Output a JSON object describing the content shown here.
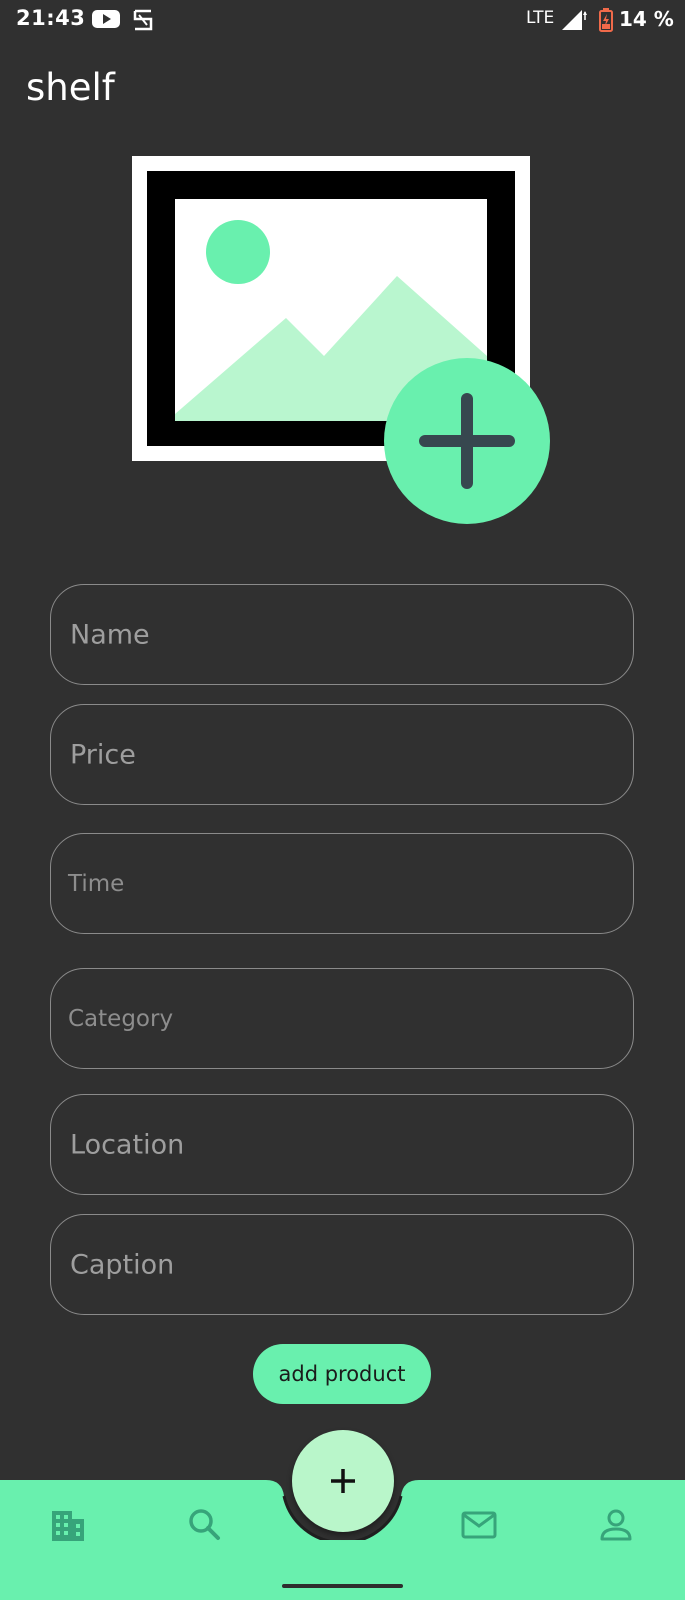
{
  "status_bar": {
    "time": "21:43",
    "network": "LTE",
    "battery": "14 %",
    "icons": [
      "youtube-icon",
      "s-app-icon",
      "signal-icon",
      "battery-icon"
    ]
  },
  "app_bar": {
    "title": "shelf"
  },
  "image_picker": {
    "placeholder_icon": "image-placeholder-icon",
    "add_icon": "plus-icon"
  },
  "form": {
    "name_label": "Name",
    "price_label": "Price",
    "time_label": "Time",
    "category_label": "Category",
    "location_label": "Location",
    "caption_label": "Caption",
    "submit_label": "add product"
  },
  "bottom_nav": {
    "items": [
      {
        "icon": "building-icon"
      },
      {
        "icon": "search-icon"
      },
      {
        "icon": "plus-icon"
      },
      {
        "icon": "mail-icon"
      },
      {
        "icon": "person-icon"
      }
    ]
  },
  "colors": {
    "background": "#303030",
    "accent": "#69f0ae",
    "accent_light": "#b9f6ca",
    "icon_dark": "#37474f",
    "field_border": "#8a8a8a",
    "label_text": "#9e9e9e"
  }
}
